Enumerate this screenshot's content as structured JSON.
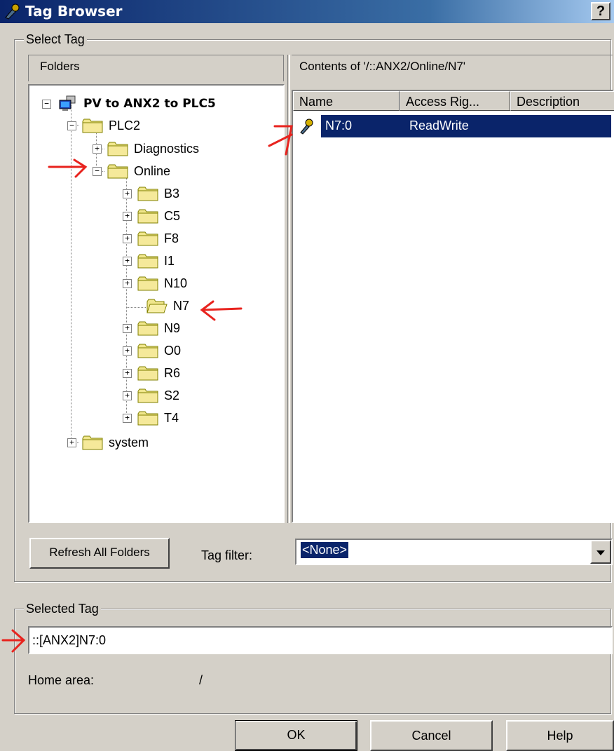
{
  "window": {
    "title": "Tag Browser",
    "help_label": "?"
  },
  "select_tag": {
    "group_label": "Select Tag",
    "folders_header": "Folders",
    "contents_header": "Contents of '/::ANX2/Online/N7'",
    "tree": {
      "root": "PV to ANX2 to PLC5",
      "plc2": "PLC2",
      "diagnostics": "Diagnostics",
      "online": "Online",
      "online_children": [
        "B3",
        "C5",
        "F8",
        "I1",
        "N10",
        "N7",
        "N9",
        "O0",
        "R6",
        "S2",
        "T4"
      ],
      "system": "system"
    },
    "columns": [
      "Name",
      "Access Rig...",
      "Description"
    ],
    "rows": [
      {
        "name": "N7:0",
        "access": "ReadWrite",
        "description": ""
      }
    ],
    "refresh_label": "Refresh All Folders",
    "tag_filter_label": "Tag filter:",
    "tag_filter_value": "<None>"
  },
  "selected_tag": {
    "group_label": "Selected Tag",
    "value": "::[ANX2]N7:0",
    "home_area_label": "Home area:",
    "home_area_value": "/"
  },
  "buttons": {
    "ok": "OK",
    "cancel": "Cancel",
    "help": "Help"
  },
  "colors": {
    "selection": "#0a246a",
    "annotation": "#e8231e",
    "folder": "#f0e68c"
  }
}
